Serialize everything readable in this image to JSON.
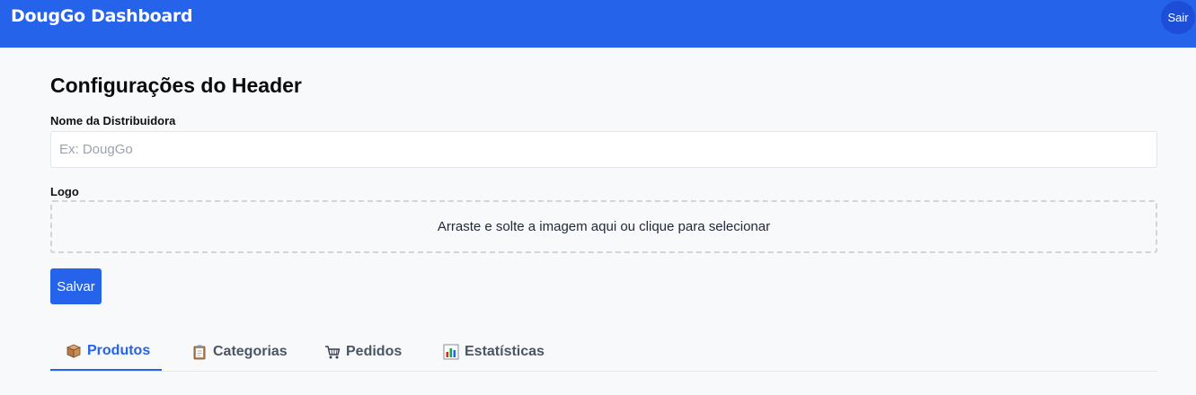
{
  "header": {
    "brand": "DougGo Dashboard",
    "logout_label": "Sair"
  },
  "settings": {
    "title": "Configurações do Header",
    "name_label": "Nome da Distribuidora",
    "name_value": "",
    "name_placeholder": "Ex: DougGo",
    "logo_label": "Logo",
    "dropzone_text": "Arraste e solte a imagem aqui ou clique para selecionar",
    "save_label": "Salvar"
  },
  "tabs": [
    {
      "label": "Produtos",
      "icon": "package-icon",
      "active": true
    },
    {
      "label": "Categorias",
      "icon": "clipboard-icon",
      "active": false
    },
    {
      "label": "Pedidos",
      "icon": "shopping-cart-icon",
      "active": false
    },
    {
      "label": "Estatísticas",
      "icon": "bar-chart-icon",
      "active": false
    }
  ],
  "colors": {
    "primary": "#2563eb",
    "background": "#f8f9fb"
  }
}
